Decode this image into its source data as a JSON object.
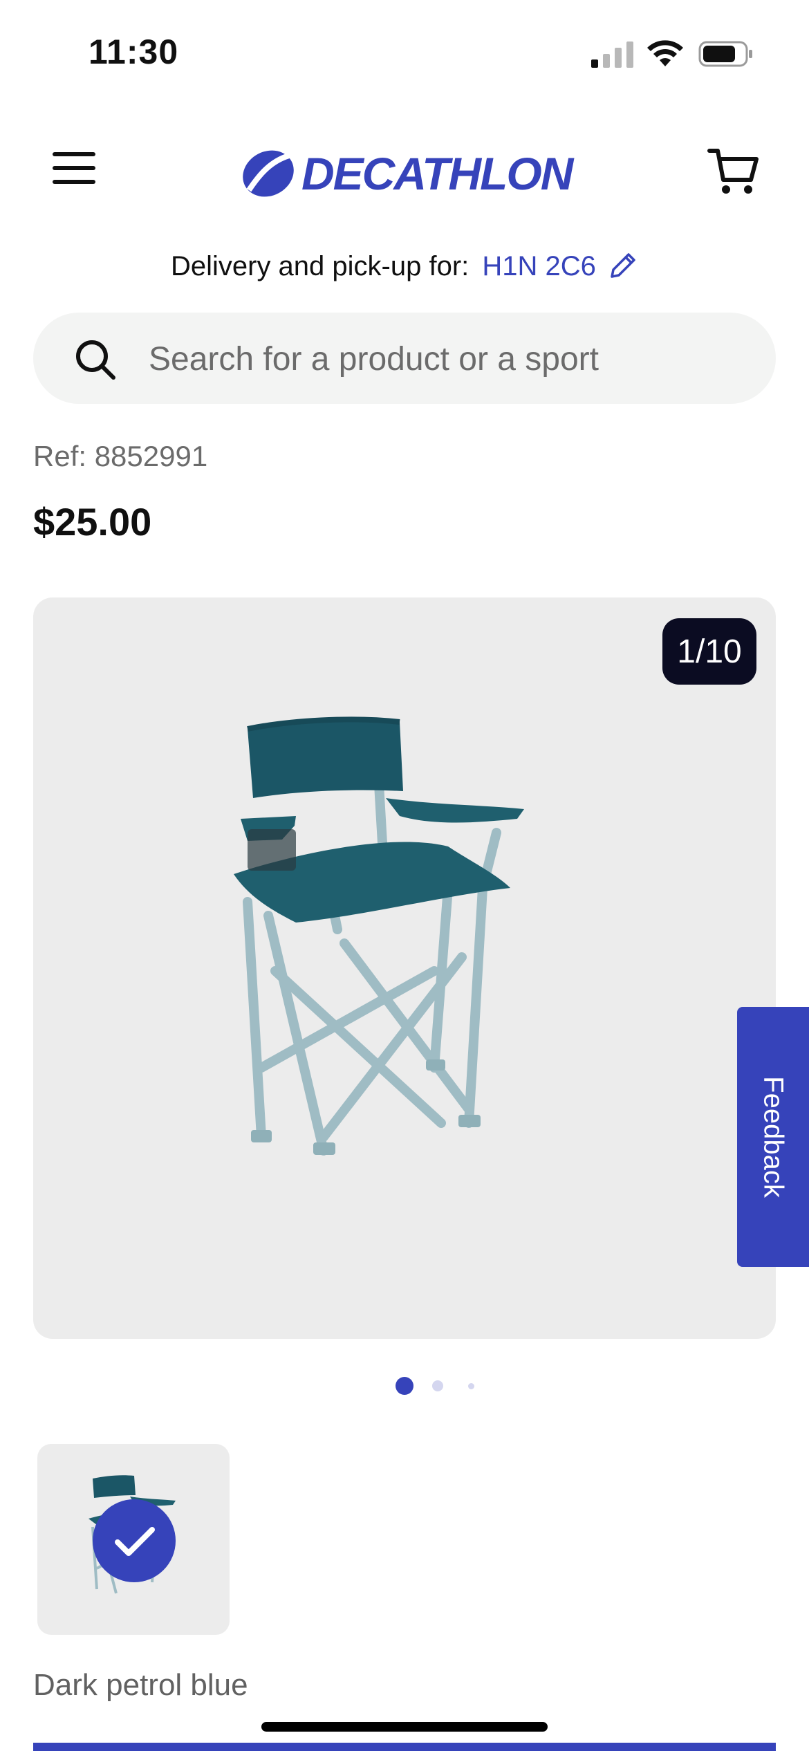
{
  "status_bar": {
    "time": "11:30"
  },
  "header": {
    "logo_text": "DECATHLON"
  },
  "delivery": {
    "label": "Delivery and pick-up for:",
    "postal_code": "H1N 2C6"
  },
  "search": {
    "placeholder": "Search for a product or a sport"
  },
  "product": {
    "ref": "Ref: 8852991",
    "price": "$25.00",
    "image_counter": "1/10",
    "color_name": "Dark petrol blue"
  },
  "carousel": {
    "active_index": 1,
    "dot_count": 3
  },
  "feedback": {
    "label": "Feedback"
  },
  "colors": {
    "brand": "#3643ba",
    "counter_bg": "#0b0c22",
    "chair": "#1f5f6e",
    "frame": "#9fbcc4"
  }
}
